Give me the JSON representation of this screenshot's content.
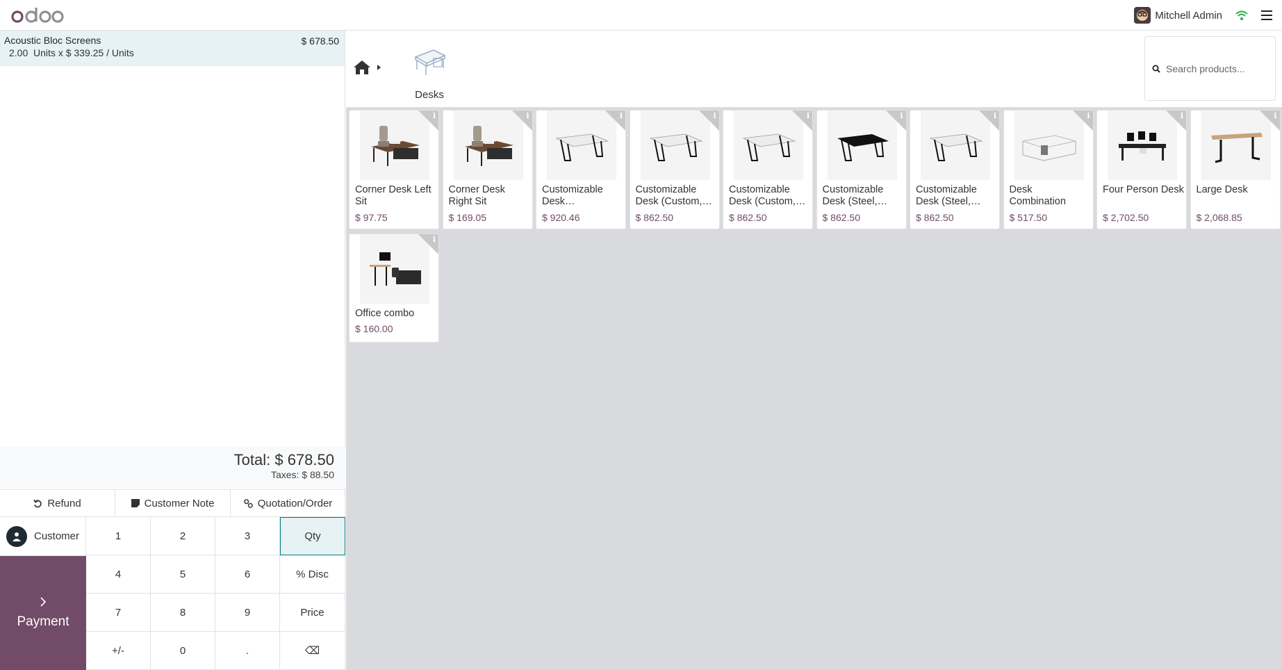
{
  "header": {
    "logo": "odoo",
    "user_name": "Mitchell Admin"
  },
  "order": {
    "lines": [
      {
        "name": "Acoustic Bloc Screens",
        "price": "$ 678.50",
        "qty": "2.00",
        "detail": "Units x $ 339.25 / Units"
      }
    ],
    "total": "Total: $ 678.50",
    "taxes": "Taxes: $ 88.50"
  },
  "actions": {
    "refund": "Refund",
    "customer_note": "Customer Note",
    "quotation": "Quotation/Order"
  },
  "pad": {
    "customer": "Customer",
    "payment": "Payment",
    "keys": [
      "1",
      "2",
      "3",
      "Qty",
      "4",
      "5",
      "6",
      "% Disc",
      "7",
      "8",
      "9",
      "Price",
      "+/-",
      "0",
      ".",
      "⌫"
    ],
    "active_mode": "Qty"
  },
  "category": {
    "label": "Desks"
  },
  "search": {
    "placeholder": "Search products..."
  },
  "products": [
    {
      "name": "Corner Desk Left Sit",
      "price": "$ 97.75",
      "image": "corner-desk-photo"
    },
    {
      "name": "Corner Desk Right Sit",
      "price": "$ 169.05",
      "image": "corner-desk-photo"
    },
    {
      "name": "Customizable Desk…",
      "price": "$ 920.46",
      "image": "white-desk"
    },
    {
      "name": "Customizable Desk (Custom,…",
      "price": "$ 862.50",
      "image": "white-desk"
    },
    {
      "name": "Customizable Desk (Custom,…",
      "price": "$ 862.50",
      "image": "white-desk"
    },
    {
      "name": "Customizable Desk (Steel,…",
      "price": "$ 862.50",
      "image": "black-desk"
    },
    {
      "name": "Customizable Desk (Steel,…",
      "price": "$ 862.50",
      "image": "white-desk"
    },
    {
      "name": "Desk Combination",
      "price": "$ 517.50",
      "image": "desk-combination"
    },
    {
      "name": "Four Person Desk",
      "price": "$ 2,702.50",
      "image": "four-person-desk"
    },
    {
      "name": "Large Desk",
      "price": "$ 2,068.85",
      "image": "large-desk"
    },
    {
      "name": "Office combo",
      "price": "$ 160.00",
      "image": "office-combo"
    }
  ]
}
